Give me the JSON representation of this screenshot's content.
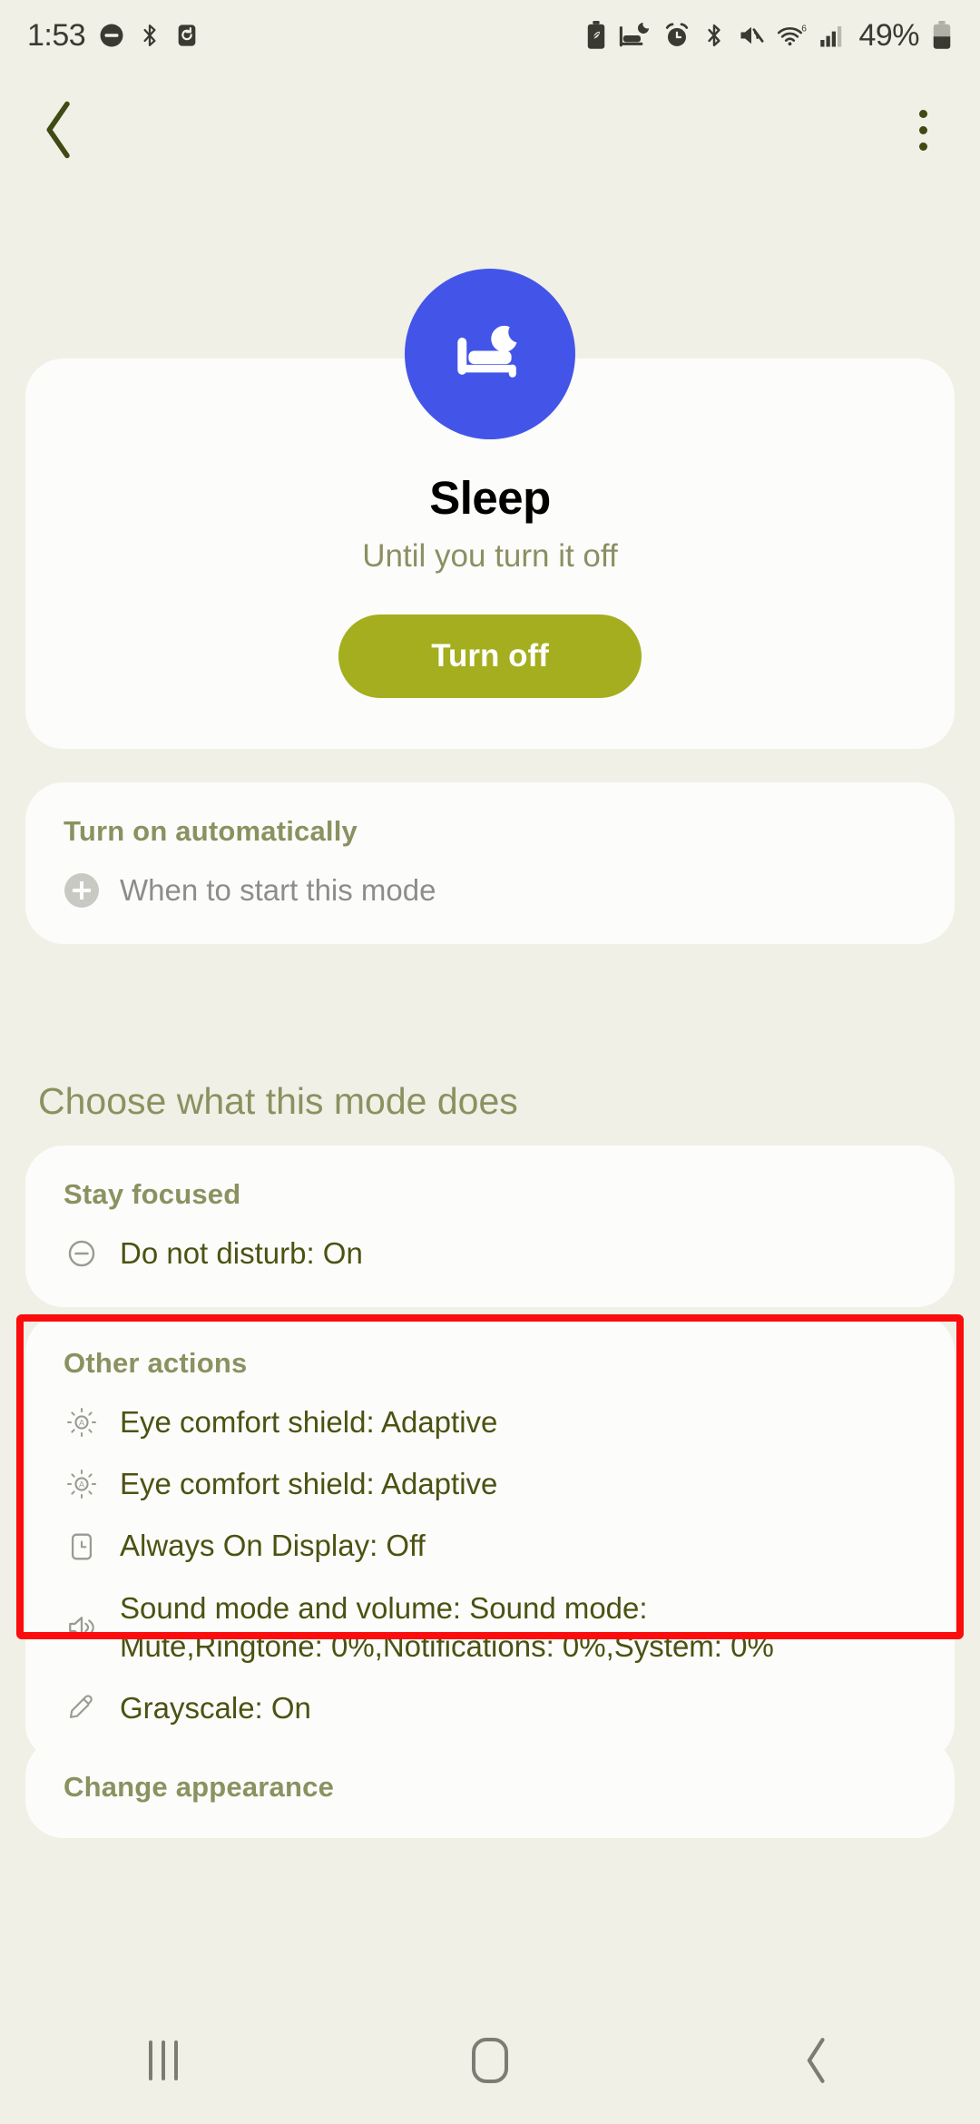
{
  "statusbar": {
    "time": "1:53",
    "battery_percent": "49%",
    "left_icons": [
      "dnd-icon",
      "bluetooth-icon",
      "alarm-reset-icon"
    ],
    "right_icons": [
      "battery-saver-icon",
      "sleep-mode-icon",
      "alarm-icon",
      "bluetooth-icon",
      "mute-icon",
      "wifi6-icon",
      "signal-icon",
      "battery-icon"
    ]
  },
  "topnav": {
    "back": "back-arrow",
    "more": "more-options"
  },
  "hero": {
    "icon": "sleep-bed-moon-icon",
    "title": "Sleep",
    "subtitle": "Until you turn it off",
    "button_label": "Turn off",
    "button_color": "#a4ae1e",
    "icon_bg": "#4355e8"
  },
  "auto_section": {
    "header": "Turn on automatically",
    "rows": [
      {
        "icon": "plus-circle-icon",
        "label": "When to start this mode"
      }
    ]
  },
  "choose_heading": "Choose what this mode does",
  "focus_section": {
    "header": "Stay focused",
    "rows": [
      {
        "icon": "do-not-disturb-icon",
        "label": "Do not disturb: On"
      }
    ]
  },
  "other_section": {
    "header": "Other actions",
    "rows": [
      {
        "icon": "eye-comfort-shield-icon",
        "label": "Eye comfort shield: Adaptive"
      },
      {
        "icon": "eye-comfort-shield-icon",
        "label": "Eye comfort shield: Adaptive"
      },
      {
        "icon": "always-on-display-icon",
        "label": "Always On Display: Off"
      },
      {
        "icon": "sound-volume-icon",
        "label_line1": "Sound mode and volume: Sound mode:",
        "label_line2": "Mute,Ringtone: 0%,Notifications: 0%,System: 0%"
      },
      {
        "icon": "grayscale-dropper-icon",
        "label": "Grayscale: On"
      }
    ],
    "highlight_color": "#fb0d0d"
  },
  "appearance_section": {
    "header": "Change appearance"
  },
  "navbar": {
    "recents": "recents-button",
    "home": "home-button",
    "back": "back-button"
  }
}
